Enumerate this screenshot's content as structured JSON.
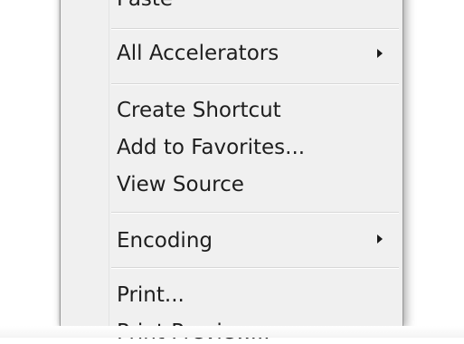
{
  "context_menu": {
    "items": [
      {
        "label": "Paste",
        "has_submenu": false
      },
      {
        "label": "All Accelerators",
        "has_submenu": true
      },
      {
        "label": "Create Shortcut",
        "has_submenu": false
      },
      {
        "label": "Add to Favorites...",
        "has_submenu": false
      },
      {
        "label": "View Source",
        "has_submenu": false
      },
      {
        "label": "Encoding",
        "has_submenu": true
      },
      {
        "label": "Print...",
        "has_submenu": false
      },
      {
        "label": "Print Preview...",
        "has_submenu": false
      }
    ],
    "icons": {
      "submenu": "chevron-right-icon"
    },
    "colors": {
      "menu_background": "#f0f0f0",
      "text": "#1e1e1e",
      "separator": "#d7d7d7"
    }
  }
}
